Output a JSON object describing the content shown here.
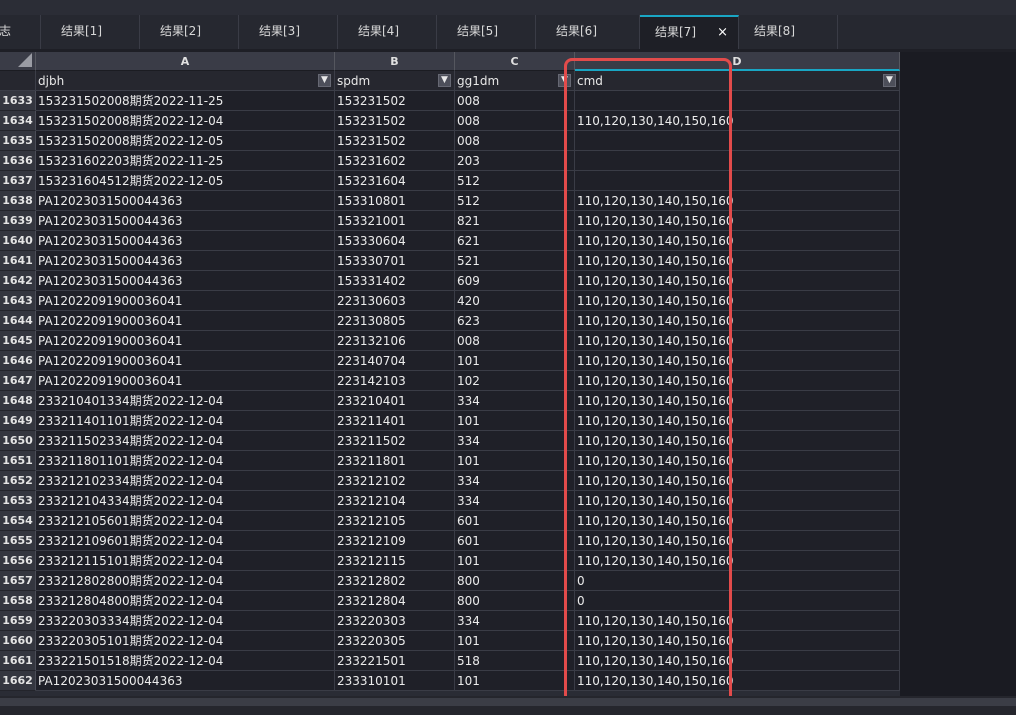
{
  "tabs": [
    {
      "label": "志",
      "active": false
    },
    {
      "label": "结果[1]",
      "active": false
    },
    {
      "label": "结果[2]",
      "active": false
    },
    {
      "label": "结果[3]",
      "active": false
    },
    {
      "label": "结果[4]",
      "active": false
    },
    {
      "label": "结果[5]",
      "active": false
    },
    {
      "label": "结果[6]",
      "active": false
    },
    {
      "label": "结果[7]",
      "active": true,
      "close": "×"
    },
    {
      "label": "结果[8]",
      "active": false
    }
  ],
  "grid": {
    "column_letters": [
      "A",
      "B",
      "C",
      "D"
    ],
    "field_names": [
      "djbh",
      "spdm",
      "gg1dm",
      "cmd"
    ],
    "dropdown_icon": "chevron-down-icon",
    "rows": [
      {
        "num": "1633",
        "cells": [
          "153231502008期货2022-11-25",
          "153231502",
          "008",
          ""
        ]
      },
      {
        "num": "1634",
        "cells": [
          "153231502008期货2022-12-04",
          "153231502",
          "008",
          "110,120,130,140,150,160"
        ]
      },
      {
        "num": "1635",
        "cells": [
          "153231502008期货2022-12-05",
          "153231502",
          "008",
          ""
        ]
      },
      {
        "num": "1636",
        "cells": [
          "153231602203期货2022-11-25",
          "153231602",
          "203",
          ""
        ]
      },
      {
        "num": "1637",
        "cells": [
          "153231604512期货2022-12-05",
          "153231604",
          "512",
          ""
        ]
      },
      {
        "num": "1638",
        "cells": [
          "PA12023031500044363",
          "153310801",
          "512",
          "110,120,130,140,150,160"
        ]
      },
      {
        "num": "1639",
        "cells": [
          "PA12023031500044363",
          "153321001",
          "821",
          "110,120,130,140,150,160"
        ]
      },
      {
        "num": "1640",
        "cells": [
          "PA12023031500044363",
          "153330604",
          "621",
          "110,120,130,140,150,160"
        ]
      },
      {
        "num": "1641",
        "cells": [
          "PA12023031500044363",
          "153330701",
          "521",
          "110,120,130,140,150,160"
        ]
      },
      {
        "num": "1642",
        "cells": [
          "PA12023031500044363",
          "153331402",
          "609",
          "110,120,130,140,150,160"
        ]
      },
      {
        "num": "1643",
        "cells": [
          "PA12022091900036041",
          "223130603",
          "420",
          "110,120,130,140,150,160"
        ]
      },
      {
        "num": "1644",
        "cells": [
          "PA12022091900036041",
          "223130805",
          "623",
          "110,120,130,140,150,160"
        ]
      },
      {
        "num": "1645",
        "cells": [
          "PA12022091900036041",
          "223132106",
          "008",
          "110,120,130,140,150,160"
        ]
      },
      {
        "num": "1646",
        "cells": [
          "PA12022091900036041",
          "223140704",
          "101",
          "110,120,130,140,150,160"
        ]
      },
      {
        "num": "1647",
        "cells": [
          "PA12022091900036041",
          "223142103",
          "102",
          "110,120,130,140,150,160"
        ]
      },
      {
        "num": "1648",
        "cells": [
          "233210401334期货2022-12-04",
          "233210401",
          "334",
          "110,120,130,140,150,160"
        ]
      },
      {
        "num": "1649",
        "cells": [
          "233211401101期货2022-12-04",
          "233211401",
          "101",
          "110,120,130,140,150,160"
        ]
      },
      {
        "num": "1650",
        "cells": [
          "233211502334期货2022-12-04",
          "233211502",
          "334",
          "110,120,130,140,150,160"
        ]
      },
      {
        "num": "1651",
        "cells": [
          "233211801101期货2022-12-04",
          "233211801",
          "101",
          "110,120,130,140,150,160"
        ]
      },
      {
        "num": "1652",
        "cells": [
          "233212102334期货2022-12-04",
          "233212102",
          "334",
          "110,120,130,140,150,160"
        ]
      },
      {
        "num": "1653",
        "cells": [
          "233212104334期货2022-12-04",
          "233212104",
          "334",
          "110,120,130,140,150,160"
        ]
      },
      {
        "num": "1654",
        "cells": [
          "233212105601期货2022-12-04",
          "233212105",
          "601",
          "110,120,130,140,150,160"
        ]
      },
      {
        "num": "1655",
        "cells": [
          "233212109601期货2022-12-04",
          "233212109",
          "601",
          "110,120,130,140,150,160"
        ]
      },
      {
        "num": "1656",
        "cells": [
          "233212115101期货2022-12-04",
          "233212115",
          "101",
          "110,120,130,140,150,160"
        ]
      },
      {
        "num": "1657",
        "cells": [
          "233212802800期货2022-12-04",
          "233212802",
          "800",
          "0"
        ]
      },
      {
        "num": "1658",
        "cells": [
          "233212804800期货2022-12-04",
          "233212804",
          "800",
          "0"
        ]
      },
      {
        "num": "1659",
        "cells": [
          "233220303334期货2022-12-04",
          "233220303",
          "334",
          "110,120,130,140,150,160"
        ]
      },
      {
        "num": "1660",
        "cells": [
          "233220305101期货2022-12-04",
          "233220305",
          "101",
          "110,120,130,140,150,160"
        ]
      },
      {
        "num": "1661",
        "cells": [
          "233221501518期货2022-12-04",
          "233221501",
          "518",
          "110,120,130,140,150,160"
        ]
      },
      {
        "num": "1662",
        "cells": [
          "PA12023031500044363",
          "233310101",
          "101",
          "110,120,130,140,150,160"
        ]
      }
    ]
  },
  "colors": {
    "accent": "#19a6c4",
    "highlight_box": "#e24b4b",
    "background": "#1e1f26"
  }
}
